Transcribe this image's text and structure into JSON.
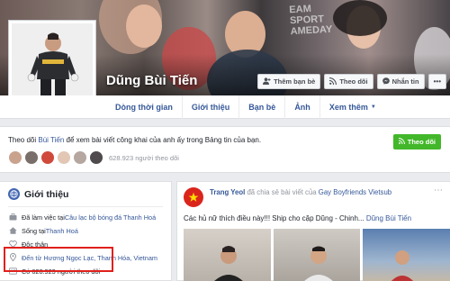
{
  "profile": {
    "name": "Dũng Bùi Tiến",
    "cover_text": "EAM\nSPORT\nAMEDAY"
  },
  "cover_buttons": [
    {
      "label": "Thêm bạn bè",
      "icon": "add-friend-icon"
    },
    {
      "label": "Theo dõi",
      "icon": "rss-icon"
    },
    {
      "label": "Nhắn tin",
      "icon": "messenger-icon"
    }
  ],
  "nav": {
    "timeline": "Dòng thời gian",
    "about": "Giới thiệu",
    "friends": "Bạn bè",
    "photos": "Ảnh",
    "more": "Xem thêm"
  },
  "follow_banner": {
    "prefix": "Theo dõi ",
    "name": "Bùi Tiến",
    "suffix": " để xem bài viết công khai của anh ấy trong Bảng tin của bạn.",
    "button": "Theo dõi",
    "follower_count": "628.923 người theo dõi"
  },
  "intro": {
    "title": "Giới thiệu",
    "rows": [
      {
        "icon": "briefcase-icon",
        "prefix": "Đã làm việc tại ",
        "link": "Câu lạc bộ bóng đá Thanh Hoá",
        "suffix": ""
      },
      {
        "icon": "home-icon",
        "prefix": "Sống tại ",
        "link": "Thanh Hoá",
        "suffix": ""
      },
      {
        "icon": "heart-icon",
        "prefix": "",
        "link": "",
        "suffix": "Độc thân"
      },
      {
        "icon": "location-icon",
        "prefix": "",
        "link": "Đến từ Hương Ngọc Lạc, Thanh Hóa, Vietnam",
        "suffix": ""
      },
      {
        "icon": "followers-icon",
        "prefix": "",
        "link": "",
        "suffix": "Có 628.923 người theo dõi"
      }
    ]
  },
  "post": {
    "author": "Trang Yeol",
    "action": " đã chia sẻ bài viết của ",
    "page": "Gay Boyfriends Vietsub",
    "body": "Các hủ nữ thích điều này!!! Ship cho cặp Dũng - Chinh... ",
    "tag": "Dũng Bùi Tiến"
  },
  "colors": {
    "facebook_blue": "#365899",
    "follow_green": "#42b72a",
    "highlight_red": "#e0201b"
  }
}
